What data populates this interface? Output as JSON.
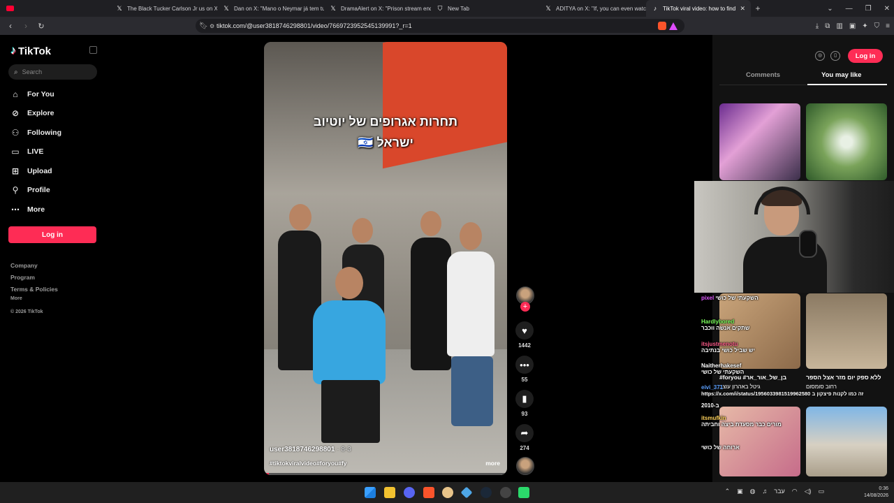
{
  "browser": {
    "tabs": [
      {
        "title": "The Black Tucker Carlson Jr us on X:",
        "icon": "x-logo-icon"
      },
      {
        "title": "Dan on X: \"Mano o Neymar já tem tu",
        "icon": "x-logo-icon"
      },
      {
        "title": "DramaAlert on X: \"Prison stream end",
        "icon": "x-logo-icon"
      },
      {
        "title": "New Tab",
        "icon": "brave-shield-icon"
      },
      {
        "title": "ADITYA on X: \"If, you can even watc",
        "icon": "x-logo-icon"
      },
      {
        "title": "TikTok viral video: how to find",
        "icon": "tiktok-icon",
        "active": true
      }
    ],
    "url": "tiktok.com/@user3818746298801/video/7669723952545139991?_r=1"
  },
  "tiktok": {
    "logo": "TikTok",
    "search_placeholder": "Search",
    "nav": [
      {
        "label": "For You",
        "icon": "home-icon"
      },
      {
        "label": "Explore",
        "icon": "compass-icon"
      },
      {
        "label": "Following",
        "icon": "following-icon"
      },
      {
        "label": "LIVE",
        "icon": "live-icon"
      },
      {
        "label": "Upload",
        "icon": "upload-icon"
      },
      {
        "label": "Profile",
        "icon": "profile-icon"
      },
      {
        "label": "More",
        "icon": "more-dots-icon"
      }
    ],
    "login_label": "Log in",
    "footer": {
      "company": "Company",
      "program": "Program",
      "terms": "Terms & Policies",
      "more": "More",
      "copyright": "© 2026 TikTok"
    }
  },
  "video": {
    "headline_line1": "תחרות אגרופים של יוטיוב",
    "headline_line2": "ישראל 🇮🇱",
    "author": "user3818746298801",
    "date": "· 8-3",
    "tags": "#tiktokviralvideo#foryou#fy",
    "more_label": "more",
    "progress": 0.02,
    "likes": "1442",
    "comments": "55",
    "saves": "93",
    "shares": "274"
  },
  "right_panel": {
    "login_label": "Log in",
    "tab_comments": "Comments",
    "tab_you_may_like": "You may like",
    "caption_right_1": "ללא ספק יום מזר אצל הספר",
    "caption_right_2": "רחוב סומסום",
    "caption_left_1": "#foryou #בן_של_אור_אר",
    "caption_left_2": "גיטל באהרון עוצב"
  },
  "chat": [
    {
      "user": "pixel",
      "text": "השקעתי של כושי",
      "color": "#e05cff"
    },
    {
      "user": "Hardlybored",
      "text": "שתקים אנשה ווכבר",
      "color": "#7cff5c"
    },
    {
      "user": "itsjustmenotu",
      "text": "יש שביל כושי בנתיבה",
      "color": "#ff5c8a"
    },
    {
      "user": "Naitherhakesef",
      "text": "השקעתי של כושי",
      "color": "#ffffff"
    },
    {
      "user": "eivi_371",
      "text": "https://x.com/i/status/1956033981519962580 זה כמו לקנות פיצקון ב",
      "color": "#5ca0ff"
    },
    {
      "user": "",
      "text": "2010-ב",
      "color": "#ffffff"
    },
    {
      "user": "itsmufkin",
      "text": "מורים כבר מסעדת ביצה וחביתה",
      "color": "#ffd25c"
    },
    {
      "user": "",
      "text": "ארוחה של כושי",
      "color": "#ffffff"
    }
  ],
  "taskbar": {
    "keyboard_lang": "עבר",
    "time": "0:36",
    "date": "14/08/2026"
  },
  "colors": {
    "accent": "#fe2c55",
    "background": "#000000",
    "panel": "#121212"
  }
}
